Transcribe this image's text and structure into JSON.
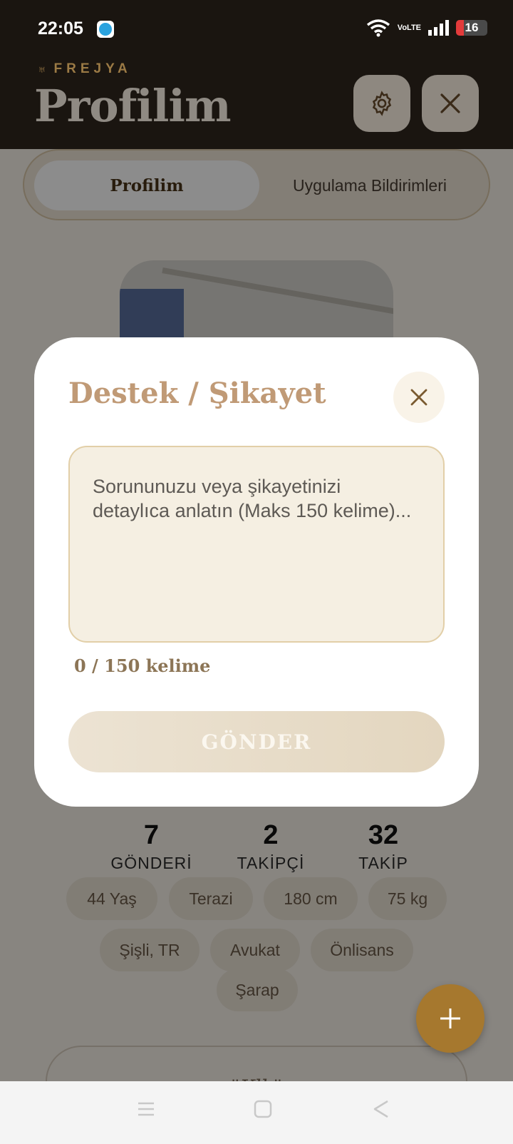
{
  "status_bar": {
    "time": "22:05",
    "network": "VoLTE",
    "battery": "16",
    "icons": [
      "telegram-icon",
      "wifi-icon",
      "signal-icon",
      "battery-icon"
    ]
  },
  "header": {
    "brand": "FREJYA",
    "title": "Profilim",
    "icons": {
      "settings": "gear-icon",
      "close": "close-icon"
    }
  },
  "tabs": [
    {
      "label": "Profilim",
      "active": true
    },
    {
      "label": "Uygulama Bildirimleri",
      "active": false
    }
  ],
  "stats": [
    {
      "value": "7",
      "label": "GÖNDERİ"
    },
    {
      "value": "2",
      "label": "TAKİPÇİ"
    },
    {
      "value": "32",
      "label": "TAKİP"
    }
  ],
  "chips": [
    "44 Yaş",
    "Terazi",
    "180 cm",
    "75 kg",
    "Şişli, TR",
    "Avukat",
    "Önlisans",
    "Şarap"
  ],
  "quote": "\"Klk\"",
  "modal": {
    "title": "Destek / Şikayet",
    "placeholder": "Sorununuzu veya şikayetinizi detaylıca anlatın (Maks 150 kelime)...",
    "word_count": "0 / 150 kelime",
    "submit": "GÖNDER"
  },
  "colors": {
    "header_bg": "#1a1510",
    "accent": "#a6782e",
    "modal_title": "#c09a76",
    "textarea_bg": "#f5efe2"
  }
}
